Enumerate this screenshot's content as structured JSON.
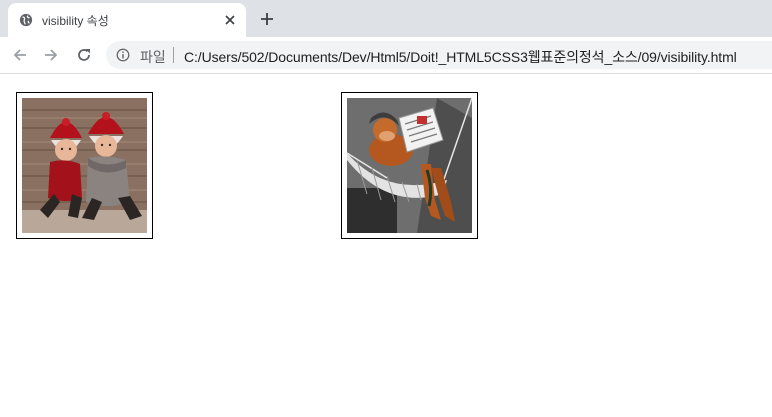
{
  "browser": {
    "tab": {
      "title": "visibility 속성",
      "favicon": "globe-icon"
    },
    "toolbar": {
      "scheme_label": "파일",
      "url": "C:/Users/502/Documents/Dev/Html5/Doit!_HTML5CSS3웹표준의정석_소스/09/visibility.html"
    },
    "icons": [
      "back-icon",
      "forward-icon",
      "reload-icon",
      "info-icon",
      "close-icon",
      "plus-icon"
    ]
  },
  "page": {
    "images": [
      {
        "name": "knitted-dolls-photo",
        "visible": true
      },
      {
        "name": "hammock-figure-photo",
        "visible": true
      }
    ]
  },
  "colors": {
    "tabstrip_bg": "#dee1e6",
    "omnibox_bg": "#f1f3f4",
    "text": "#202124",
    "frame_border": "#000000"
  }
}
